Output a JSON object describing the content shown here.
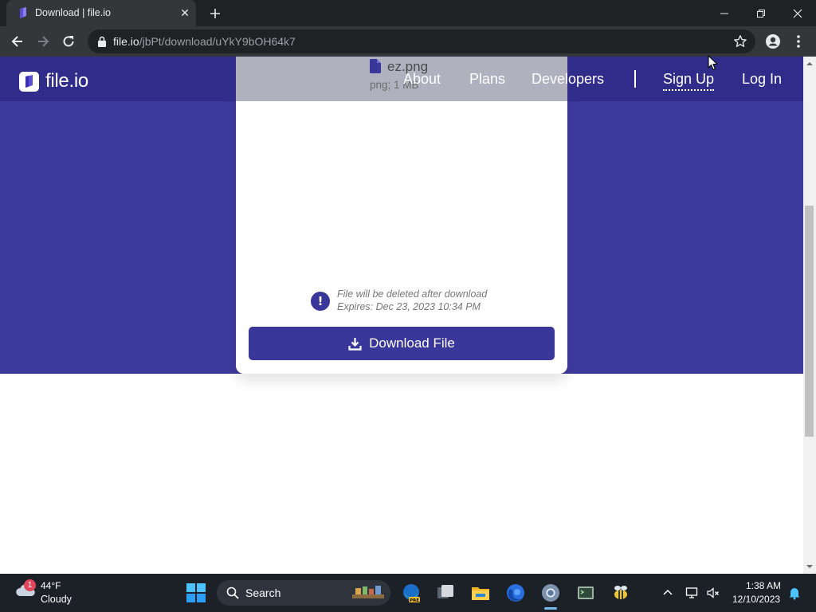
{
  "browser": {
    "tab_title": "Download | file.io",
    "url_host": "file.io",
    "url_path": "/jbPt/download/uYkY9bOH64k7"
  },
  "site": {
    "logo_text": "file.io",
    "nav": {
      "about": "About",
      "plans": "Plans",
      "developers": "Developers",
      "signup": "Sign Up",
      "login": "Log In"
    },
    "brand_color": "#3d3a9e"
  },
  "file": {
    "name": "ez.png",
    "meta": "png; 1 MB",
    "notice_line1": "File will be deleted after download",
    "notice_line2": "Expires: Dec 23, 2023 10:34 PM",
    "download_label": "Download File"
  },
  "taskbar": {
    "weather_badge": "1",
    "weather_temp": "44°F",
    "weather_desc": "Cloudy",
    "search_label": "Search",
    "time": "1:38 AM",
    "date": "12/10/2023"
  }
}
